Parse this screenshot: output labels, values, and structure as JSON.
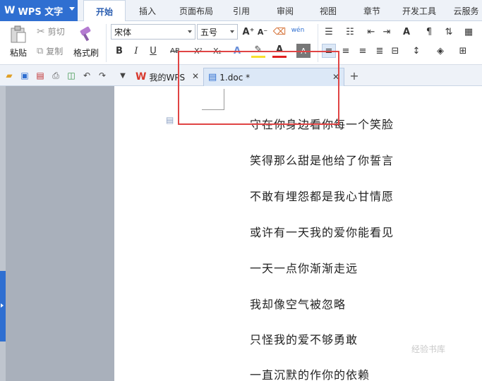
{
  "app": {
    "logo": "W",
    "name": "WPS 文字"
  },
  "menu": {
    "tabs": [
      {
        "label": "开始",
        "active": true
      },
      {
        "label": "插入"
      },
      {
        "label": "页面布局"
      },
      {
        "label": "引用"
      },
      {
        "label": "审阅"
      },
      {
        "label": "视图"
      },
      {
        "label": "章节"
      },
      {
        "label": "开发工具"
      },
      {
        "label": "云服务"
      }
    ]
  },
  "ribbon": {
    "paste_label": "粘贴",
    "cut_label": "剪切",
    "copy_label": "复制",
    "format_painter_label": "格式刷",
    "font_name": "宋体",
    "font_size": "五号",
    "grow_font": "A⁺",
    "shrink_font": "A⁻",
    "pinyin": "wén",
    "bold": "B",
    "italic": "I",
    "underline": "U",
    "strike": "AB",
    "superscript": "X²",
    "subscript": "X₂"
  },
  "doc_tabs": [
    {
      "label": "我的WPS"
    },
    {
      "label": "1.doc *"
    }
  ],
  "document": {
    "lines": [
      "守在你身边看你每一个笑脸",
      "笑得那么甜是他给了你誓言",
      "不敢有埋怨都是我心甘情愿",
      "或许有一天我的爱你能看见",
      "一天一点你渐渐走远",
      "我却像空气被忽略",
      "只怪我的爱不够勇敢",
      "一直沉默的作你的依赖"
    ]
  },
  "watermark": "经验书库"
}
